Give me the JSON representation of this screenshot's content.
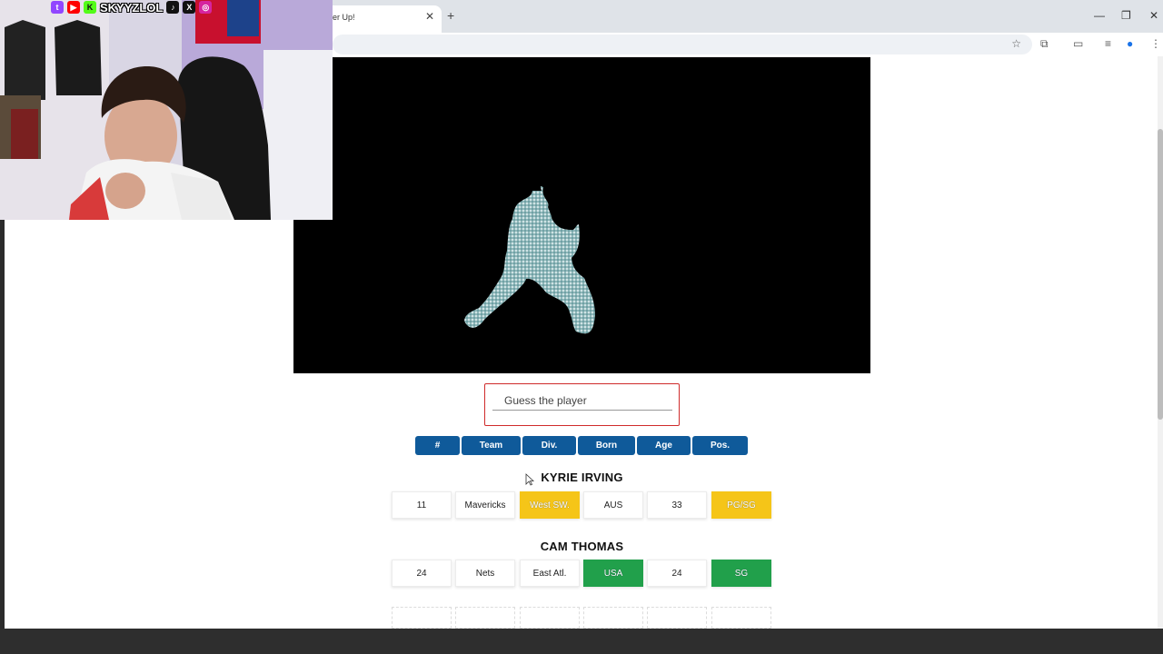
{
  "browser": {
    "tab_title": "er Up!",
    "tab_close": "✕",
    "new_tab": "+",
    "window_controls": [
      "—",
      "❐",
      "✕"
    ]
  },
  "overlay": {
    "handle": "SKYYZLOL",
    "social_icons": [
      "twitch-icon",
      "youtube-icon",
      "kick-icon",
      "tiktok-icon",
      "x-icon",
      "instagram-icon"
    ],
    "social_glyphs": [
      "t",
      "▶",
      "K",
      "♪",
      "X",
      "◎"
    ],
    "social_colors": [
      "#9146ff",
      "#ff0000",
      "#53fc18",
      "#111111",
      "#111111",
      "#d6249f"
    ]
  },
  "game": {
    "guess_placeholder": "Guess the player",
    "headers": [
      "#",
      "Team",
      "Div.",
      "Born",
      "Age",
      "Pos."
    ],
    "guesses": [
      {
        "name": "KYRIE IRVING",
        "cells": [
          {
            "value": "11",
            "status": "none"
          },
          {
            "value": "Mavericks",
            "status": "none"
          },
          {
            "value": "West SW.",
            "status": "close"
          },
          {
            "value": "AUS",
            "status": "none"
          },
          {
            "value": "33",
            "status": "none"
          },
          {
            "value": "PG/SG",
            "status": "close"
          }
        ]
      },
      {
        "name": "CAM THOMAS",
        "cells": [
          {
            "value": "24",
            "status": "none"
          },
          {
            "value": "Nets",
            "status": "none"
          },
          {
            "value": "East Atl.",
            "status": "none"
          },
          {
            "value": "USA",
            "status": "correct"
          },
          {
            "value": "24",
            "status": "none"
          },
          {
            "value": "SG",
            "status": "correct"
          }
        ]
      }
    ],
    "status_colors": {
      "close": "#f5c518",
      "correct": "#21a04b"
    }
  }
}
